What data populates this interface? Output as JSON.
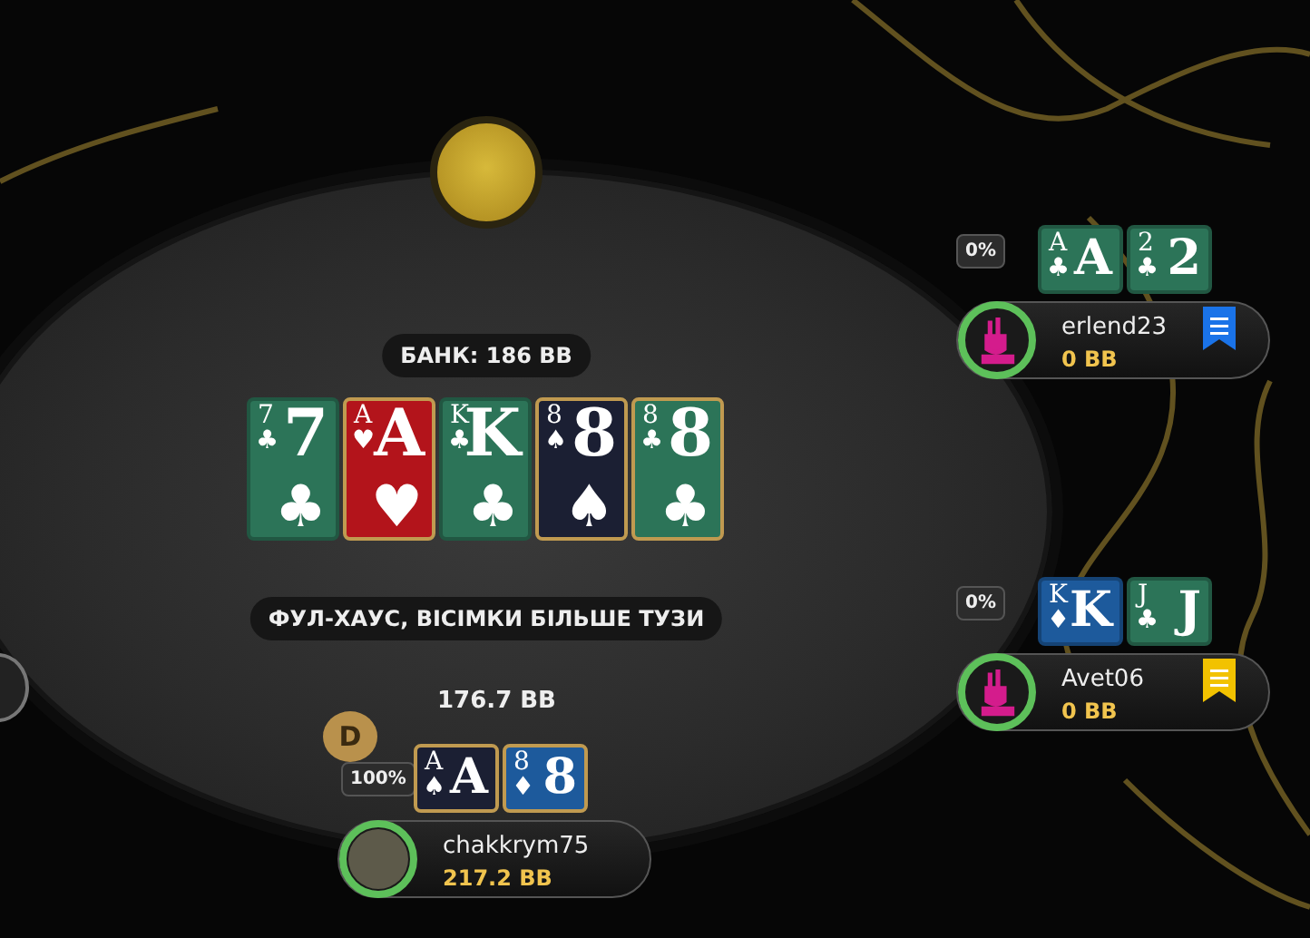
{
  "pot": {
    "label": "БАНК: 186 BB"
  },
  "board": [
    {
      "corner": "7",
      "corner_suit": "♣",
      "rank": "7",
      "suit": "♣",
      "color": "#2c7458",
      "highlighted": false
    },
    {
      "corner": "A",
      "corner_suit": "♥",
      "rank": "A",
      "suit": "♥",
      "color": "#b3141b",
      "highlighted": true
    },
    {
      "corner": "K",
      "corner_suit": "♣",
      "rank": "K",
      "suit": "♣",
      "color": "#2c7458",
      "highlighted": false
    },
    {
      "corner": "8",
      "corner_suit": "♠",
      "rank": "8",
      "suit": "♠",
      "color": "#1b1f33",
      "highlighted": true
    },
    {
      "corner": "8",
      "corner_suit": "♣",
      "rank": "8",
      "suit": "♣",
      "color": "#2c7458",
      "highlighted": true
    }
  ],
  "hand_result": "ФУЛ-ХАУС, ВІСІМКИ БІЛЬШЕ ТУЗИ",
  "bet": "176.7 BB",
  "dealer_button": "D",
  "players": [
    {
      "name": "erlend23",
      "stack": "0 BB",
      "equity": "0%",
      "avatar": {
        "kind": "logo"
      },
      "note": {
        "color": "#1a73e8"
      },
      "cards": [
        {
          "corner": "A",
          "corner_suit": "♣",
          "rank": "A",
          "color": "#2c7458",
          "highlighted": false
        },
        {
          "corner": "2",
          "corner_suit": "♣",
          "rank": "2",
          "color": "#2c7458",
          "highlighted": false
        }
      ]
    },
    {
      "name": "Avet06",
      "stack": "0 BB",
      "equity": "0%",
      "avatar": {
        "kind": "logo"
      },
      "note": {
        "color": "#f2c200"
      },
      "cards": [
        {
          "corner": "K",
          "corner_suit": "♦",
          "rank": "K",
          "color": "#1d5a9c",
          "highlighted": false
        },
        {
          "corner": "J",
          "corner_suit": "♣",
          "rank": "J",
          "color": "#2c7458",
          "highlighted": false
        }
      ]
    },
    {
      "name": "chakkrym75",
      "stack": "217.2 BB",
      "equity": "100%",
      "avatar": {
        "kind": "photo"
      },
      "cards": [
        {
          "corner": "A",
          "corner_suit": "♠",
          "rank": "A",
          "color": "#1b1f33",
          "highlighted": true
        },
        {
          "corner": "8",
          "corner_suit": "♦",
          "rank": "8",
          "color": "#1d5a9c",
          "highlighted": true
        }
      ]
    }
  ]
}
